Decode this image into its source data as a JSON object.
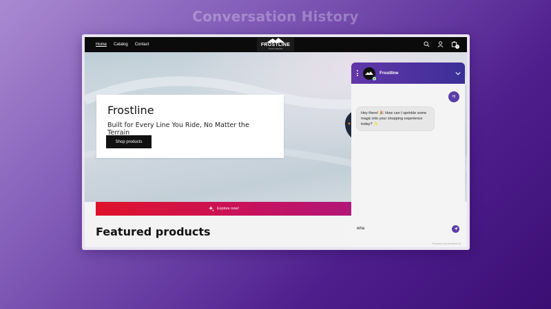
{
  "page": {
    "heading": "Conversation History"
  },
  "nav": {
    "links": [
      "Home",
      "Catalog",
      "Contact"
    ],
    "cart_count": "1"
  },
  "logo": {
    "text": "FROSTLINE",
    "tagline": "SNOW BRAND"
  },
  "hero": {
    "title": "Frostline",
    "subtitle": "Built for Every Line You Ride, No Matter the Terrain",
    "button_label": "Shop products"
  },
  "promo": {
    "label": "Explore now!"
  },
  "featured": {
    "title": "Featured products"
  },
  "chat": {
    "bot_name": "Frostline",
    "user_message": "Hi",
    "bot_message": "Hey there! 🎉 How can I sprinkle some magic into your shopping experience today? ✨",
    "input_value": "wha",
    "powered_by": "Powered by Manifest AI"
  },
  "colors": {
    "accent": "#5b3ea7",
    "promo_start": "#e0122a",
    "promo_end": "#b01777",
    "online": "#36c25a"
  }
}
